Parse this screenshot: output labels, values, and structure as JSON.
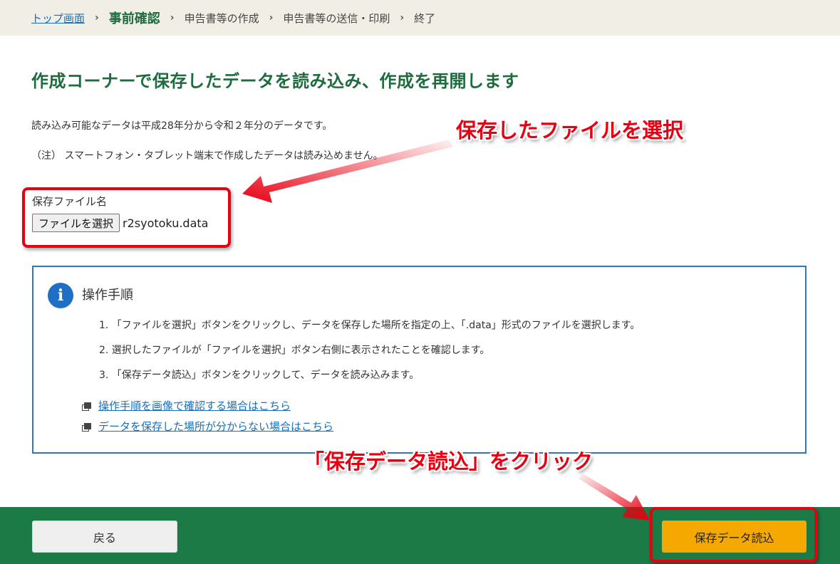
{
  "breadcrumb": {
    "top": "トップ画面",
    "sep": "›",
    "current": "事前確認",
    "step3": "申告書等の作成",
    "step4": "申告書等の送信・印刷",
    "step5": "終了"
  },
  "page": {
    "title": "作成コーナーで保存したデータを読み込み、作成を再開します",
    "desc1": "読み込み可能なデータは平成28年分から令和２年分のデータです。",
    "desc2": "（注） スマートフォン・タブレット端末で作成したデータは読み込めません。"
  },
  "file_field": {
    "label": "保存ファイル名",
    "button_label": "ファイルを選択",
    "file_name": "r2syotoku.data"
  },
  "panel": {
    "icon": "info-icon",
    "title": "操作手順",
    "steps": [
      "1. 「ファイルを選択」ボタンをクリックし、データを保存した場所を指定の上、「.data」形式のファイルを選択します。",
      "2. 選択したファイルが「ファイルを選択」ボタン右側に表示されたことを確認します。",
      "3. 「保存データ読込」ボタンをクリックして、データを読み込みます。"
    ],
    "links": [
      "操作手順を画像で確認する場合はこちら",
      "データを保存した場所が分からない場合はこちら"
    ]
  },
  "footer": {
    "back_label": "戻る",
    "submit_label": "保存データ読込"
  },
  "annotations": {
    "callout_file": "保存したファイルを選択",
    "callout_submit": "「保存データ読込」をクリック"
  },
  "colors": {
    "brand_green": "#1e6b3e",
    "footer_green": "#1b7a45",
    "accent_orange": "#f5a800",
    "link_blue": "#1a6fb8",
    "annotation_red": "#e60012"
  }
}
